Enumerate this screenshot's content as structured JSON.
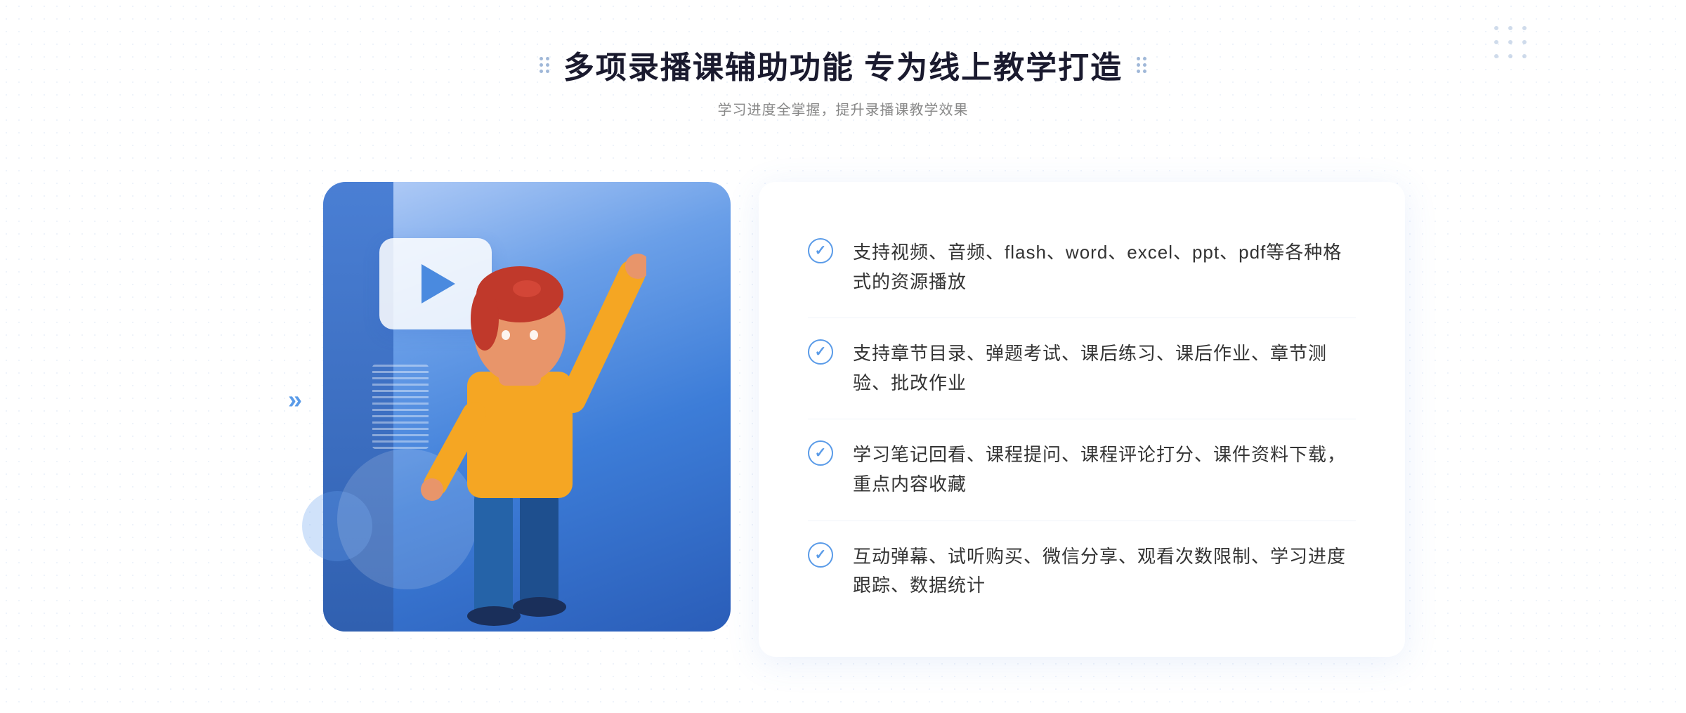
{
  "header": {
    "title": "多项录播课辅助功能 专为线上教学打造",
    "subtitle": "学习进度全掌握，提升录播课教学效果"
  },
  "features": [
    {
      "id": "feature-1",
      "text": "支持视频、音频、flash、word、excel、ppt、pdf等各种格式的资源播放"
    },
    {
      "id": "feature-2",
      "text": "支持章节目录、弹题考试、课后练习、课后作业、章节测验、批改作业"
    },
    {
      "id": "feature-3",
      "text": "学习笔记回看、课程提问、课程评论打分、课件资料下载，重点内容收藏"
    },
    {
      "id": "feature-4",
      "text": "互动弹幕、试听购买、微信分享、观看次数限制、学习进度跟踪、数据统计"
    }
  ],
  "decoration": {
    "left_chevrons": "»",
    "check_symbol": "✓"
  }
}
